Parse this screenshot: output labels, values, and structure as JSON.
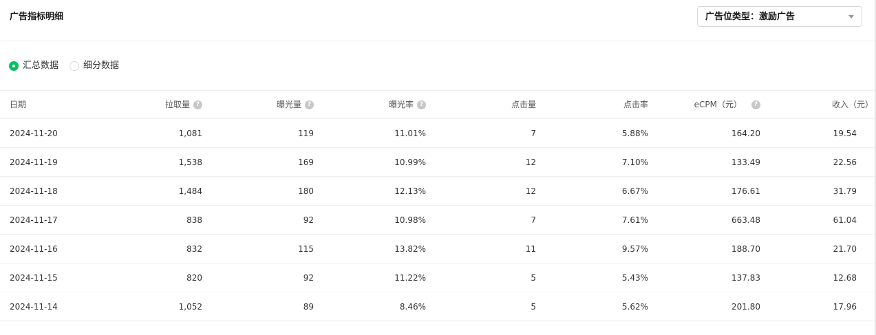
{
  "header": {
    "title": "广告指标明细",
    "ad_slot_select": {
      "value": "广告位类型：激励广告"
    }
  },
  "view_mode": {
    "options": [
      {
        "label": "汇总数据",
        "checked": true
      },
      {
        "label": "细分数据",
        "checked": false
      }
    ]
  },
  "table": {
    "columns": [
      {
        "label": "日期",
        "help": false
      },
      {
        "label": "拉取量",
        "help": true
      },
      {
        "label": "曝光量",
        "help": true
      },
      {
        "label": "曝光率",
        "help": true
      },
      {
        "label": "点击量",
        "help": false
      },
      {
        "label": "点击率",
        "help": false
      },
      {
        "label": "eCPM（元）",
        "help": true
      },
      {
        "label": "收入（元）",
        "help": false
      }
    ],
    "rows": [
      [
        "2024-11-20",
        "1,081",
        "119",
        "11.01%",
        "7",
        "5.88%",
        "164.20",
        "19.54"
      ],
      [
        "2024-11-19",
        "1,538",
        "169",
        "10.99%",
        "12",
        "7.10%",
        "133.49",
        "22.56"
      ],
      [
        "2024-11-18",
        "1,484",
        "180",
        "12.13%",
        "12",
        "6.67%",
        "176.61",
        "31.79"
      ],
      [
        "2024-11-17",
        "838",
        "92",
        "10.98%",
        "7",
        "7.61%",
        "663.48",
        "61.04"
      ],
      [
        "2024-11-16",
        "832",
        "115",
        "13.82%",
        "11",
        "9.57%",
        "188.70",
        "21.70"
      ],
      [
        "2024-11-15",
        "820",
        "92",
        "11.22%",
        "5",
        "5.43%",
        "137.83",
        "12.68"
      ],
      [
        "2024-11-14",
        "1,052",
        "89",
        "8.46%",
        "5",
        "5.62%",
        "201.80",
        "17.96"
      ]
    ]
  },
  "icons": {
    "help": "question-circle-icon",
    "select_arrow": "caret-down-icon",
    "help_glyph": "?"
  },
  "colors": {
    "accent": "#07c160",
    "border": "#eeeeee",
    "help_icon": "#c7c7c7"
  }
}
